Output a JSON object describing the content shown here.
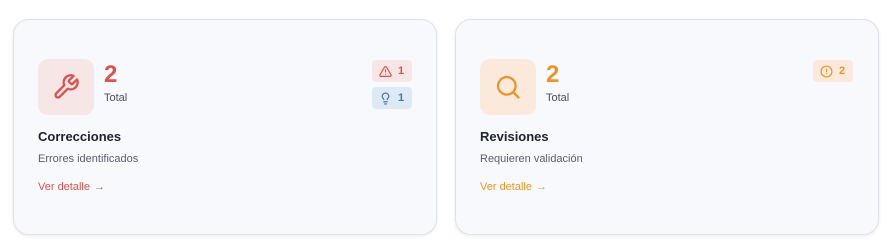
{
  "colors": {
    "danger": "#d9534f",
    "danger_bg": "#f7e6e6",
    "info": "#4a76a8",
    "info_bg": "#dde9f5",
    "warning": "#e8962a",
    "warning_bg": "#fbeadc"
  },
  "cards": [
    {
      "title": "Correcciones",
      "count": "2",
      "count_label": "Total",
      "subtitle": "Errores identificados",
      "link": "Ver detalle",
      "link_arrow": "→",
      "icon": "wrench-icon",
      "badges": [
        {
          "icon": "warning-triangle-icon",
          "value": "1"
        },
        {
          "icon": "lightbulb-icon",
          "value": "1"
        }
      ]
    },
    {
      "title": "Revisiones",
      "count": "2",
      "count_label": "Total",
      "subtitle": "Requieren validación",
      "link": "Ver detalle",
      "link_arrow": "→",
      "icon": "search-icon",
      "badges": [
        {
          "icon": "alert-circle-icon",
          "value": "2"
        }
      ]
    }
  ]
}
